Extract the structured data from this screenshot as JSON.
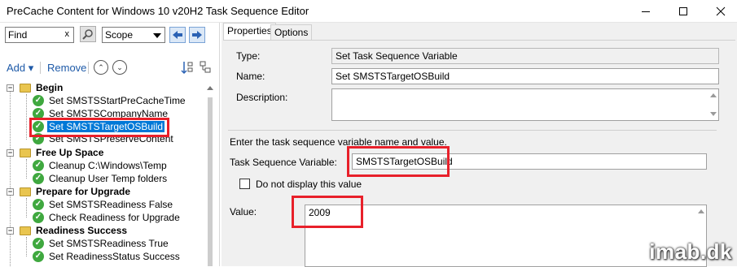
{
  "window": {
    "title": "PreCache Content for Windows 10 v20H2 Task Sequence Editor"
  },
  "search": {
    "value": "Find",
    "clear": "x",
    "scope_value": "Scope"
  },
  "toolbar": {
    "add_label": "Add",
    "remove_label": "Remove"
  },
  "tree": {
    "groups": [
      {
        "label": "Begin",
        "items": [
          "Set SMSTSStartPreCacheTime",
          "Set SMSTSCompanyName",
          "Set SMSTSTargetOSBuild",
          "Set SMSTSPreserveContent"
        ]
      },
      {
        "label": "Free Up Space",
        "items": [
          "Cleanup C:\\Windows\\Temp",
          "Cleanup User Temp folders"
        ]
      },
      {
        "label": "Prepare for Upgrade",
        "items": [
          "Set SMSTSReadiness False",
          "Check Readiness for Upgrade"
        ]
      },
      {
        "label": "Readiness Success",
        "items": [
          "Set SMSTSReadiness True",
          "Set ReadinessStatus Success"
        ]
      }
    ]
  },
  "tabs": [
    "Properties",
    "Options"
  ],
  "properties": {
    "type_label": "Type:",
    "type_value": "Set Task Sequence Variable",
    "name_label": "Name:",
    "name_value": "Set SMSTSTargetOSBuild",
    "description_label": "Description:",
    "description_value": "",
    "instructions": "Enter the task sequence variable name and value.",
    "variable_label": "Task Sequence Variable:",
    "variable_value": "SMSTSTargetOSBuild",
    "hide_label": "Do not display this value",
    "value_label": "Value:",
    "value_value": "2009"
  },
  "watermark": "imab.dk",
  "colors": {
    "highlight": "#e8202a",
    "selection": "#0078d7",
    "success": "#3fa83f"
  }
}
